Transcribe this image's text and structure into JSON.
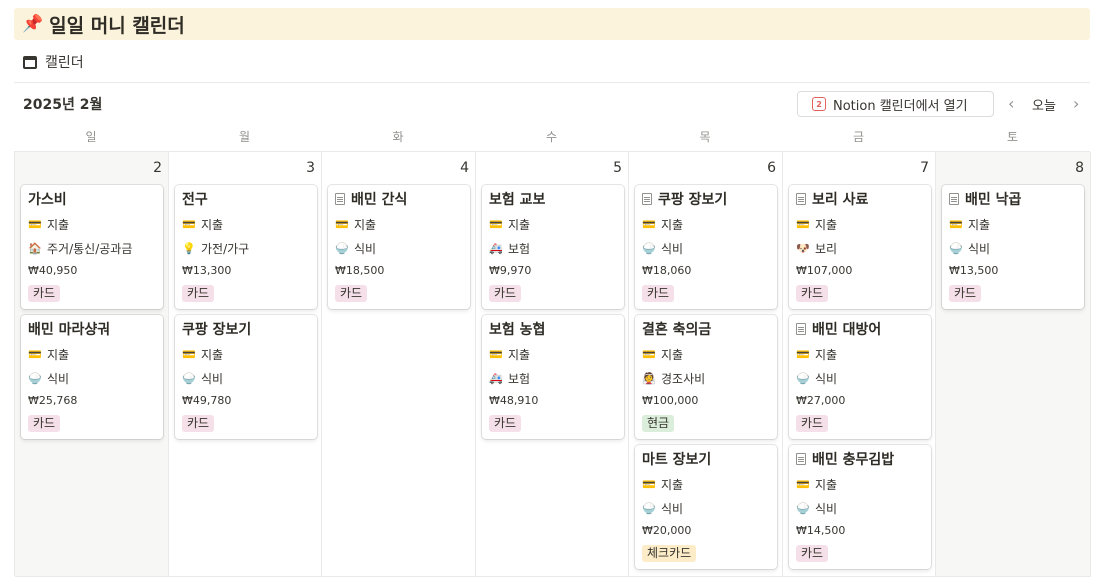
{
  "page": {
    "icon": "📌",
    "title": "일일 머니 캘린더"
  },
  "view": {
    "icon": "calendar-icon",
    "label": "캘린더"
  },
  "toolbar": {
    "month": "2025년 2월",
    "open_label": "Notion 캘린더에서 열기",
    "open_icon_text": "2",
    "prev": "‹",
    "today": "오늘",
    "next": "›"
  },
  "weekdays": [
    "일",
    "월",
    "화",
    "수",
    "목",
    "금",
    "토"
  ],
  "days": [
    "2",
    "3",
    "4",
    "5",
    "6",
    "7",
    "8"
  ],
  "tag_colors": {
    "카드": "#f5e0e9",
    "현금": "#dbeddb",
    "체크카드": "#fdecc8"
  },
  "cards": [
    [
      {
        "title": "가스비",
        "doc": false,
        "type_icon": "💳",
        "type": "지출",
        "cat_icon": "🏠",
        "category": "주거/통신/공과금",
        "amount": "₩40,950",
        "tag": "카드"
      },
      {
        "title": "배민 마라샹궈",
        "doc": false,
        "type_icon": "💳",
        "type": "지출",
        "cat_icon": "🍚",
        "category": "식비",
        "amount": "₩25,768",
        "tag": "카드"
      }
    ],
    [
      {
        "title": "전구",
        "doc": false,
        "type_icon": "💳",
        "type": "지출",
        "cat_icon": "💡",
        "category": "가전/가구",
        "amount": "₩13,300",
        "tag": "카드"
      },
      {
        "title": "쿠팡 장보기",
        "doc": false,
        "type_icon": "💳",
        "type": "지출",
        "cat_icon": "🍚",
        "category": "식비",
        "amount": "₩49,780",
        "tag": "카드"
      }
    ],
    [
      {
        "title": "배민 간식",
        "doc": true,
        "type_icon": "💳",
        "type": "지출",
        "cat_icon": "🍚",
        "category": "식비",
        "amount": "₩18,500",
        "tag": "카드"
      }
    ],
    [
      {
        "title": "보험 교보",
        "doc": false,
        "type_icon": "💳",
        "type": "지출",
        "cat_icon": "🚑",
        "category": "보험",
        "amount": "₩9,970",
        "tag": "카드"
      },
      {
        "title": "보험 농협",
        "doc": false,
        "type_icon": "💳",
        "type": "지출",
        "cat_icon": "🚑",
        "category": "보험",
        "amount": "₩48,910",
        "tag": "카드"
      }
    ],
    [
      {
        "title": "쿠팡 장보기",
        "doc": true,
        "type_icon": "💳",
        "type": "지출",
        "cat_icon": "🍚",
        "category": "식비",
        "amount": "₩18,060",
        "tag": "카드"
      },
      {
        "title": "결혼 축의금",
        "doc": false,
        "type_icon": "💳",
        "type": "지출",
        "cat_icon": "👰",
        "category": "경조사비",
        "amount": "₩100,000",
        "tag": "현금"
      },
      {
        "title": "마트 장보기",
        "doc": false,
        "type_icon": "💳",
        "type": "지출",
        "cat_icon": "🍚",
        "category": "식비",
        "amount": "₩20,000",
        "tag": "체크카드"
      }
    ],
    [
      {
        "title": "보리 사료",
        "doc": true,
        "type_icon": "💳",
        "type": "지출",
        "cat_icon": "🐶",
        "category": "보리",
        "amount": "₩107,000",
        "tag": "카드"
      },
      {
        "title": "배민 대방어",
        "doc": true,
        "type_icon": "💳",
        "type": "지출",
        "cat_icon": "🍚",
        "category": "식비",
        "amount": "₩27,000",
        "tag": "카드"
      },
      {
        "title": "배민 충무김밥",
        "doc": true,
        "type_icon": "💳",
        "type": "지출",
        "cat_icon": "🍚",
        "category": "식비",
        "amount": "₩14,500",
        "tag": "카드"
      }
    ],
    [
      {
        "title": "배민 낙곱",
        "doc": true,
        "type_icon": "💳",
        "type": "지출",
        "cat_icon": "🍚",
        "category": "식비",
        "amount": "₩13,500",
        "tag": "카드"
      }
    ]
  ]
}
